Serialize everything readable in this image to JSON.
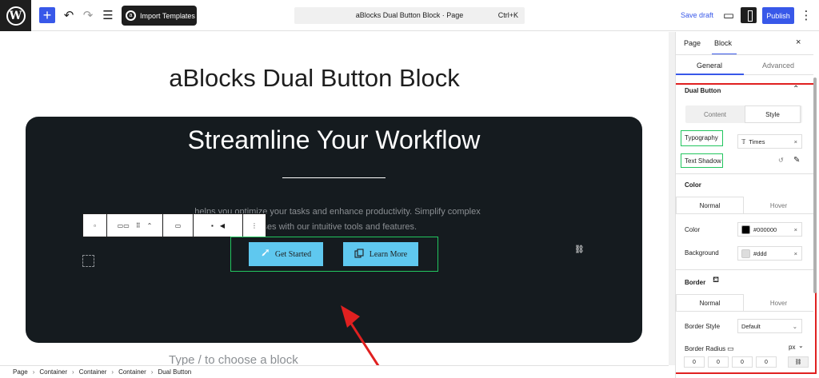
{
  "topbar": {
    "logo": "W",
    "add_icon": "+",
    "undo_icon": "↶",
    "redo_icon": "↷",
    "list_icon": "☰",
    "import_label": "Import Templates",
    "command_title": "aBlocks Dual Button Block · Page",
    "command_shortcut": "Ctrl+K",
    "save_draft": "Save draft",
    "preview_icon": "▭",
    "publish": "Publish",
    "more_icon": "⋮"
  },
  "canvas": {
    "page_title": "aBlocks Dual Button Block",
    "hero_title": "Streamline Your Workflow",
    "hero_text_line1": "helps you optimize your tasks and enhance productivity. Simplify complex",
    "hero_text_line2": "sses with our intuitive tools and features.",
    "button_primary": "Get Started",
    "button_secondary": "Learn More",
    "type_hint": "Type / to choose a block"
  },
  "block_toolbar": {
    "icon_block": "▫",
    "icon_parent": "▭▭",
    "icon_drag": "⠿",
    "icon_move": "⌃",
    "icon_align": "▭",
    "icon_comment": "▪",
    "icon_media": "◀",
    "icon_more": "⋮"
  },
  "breadcrumb": [
    "Page",
    "Container",
    "Container",
    "Container",
    "Dual Button"
  ],
  "sidebar": {
    "tab_page": "Page",
    "tab_block": "Block",
    "close": "×",
    "sub_general": "General",
    "sub_advanced": "Advanced",
    "section_dual_button": "Dual Button",
    "collapse_icon": "⌃",
    "seg_content": "Content",
    "seg_style": "Style",
    "typography_label": "Typography",
    "typography_value": "Times",
    "text_shadow_label": "Text Shadow",
    "color_section": "Color",
    "tab_normal": "Normal",
    "tab_hover": "Hover",
    "color_label": "Color",
    "color_value": "#000000",
    "background_label": "Background",
    "background_value": "#ddd",
    "border_section": "Border",
    "border_tab_normal": "Normal",
    "border_tab_hover": "Hover",
    "border_style_label": "Border Style",
    "border_style_value": "Default",
    "border_radius_label": "Border Radius",
    "border_radius_unit": "px",
    "radius_values": [
      "0",
      "0",
      "0",
      "0"
    ]
  },
  "colors": {
    "accent": "#3858e9",
    "hero_bg": "#151b1f",
    "button_bg": "#5fc8ef",
    "highlight_green": "#22c55e",
    "highlight_red": "#e02020"
  }
}
